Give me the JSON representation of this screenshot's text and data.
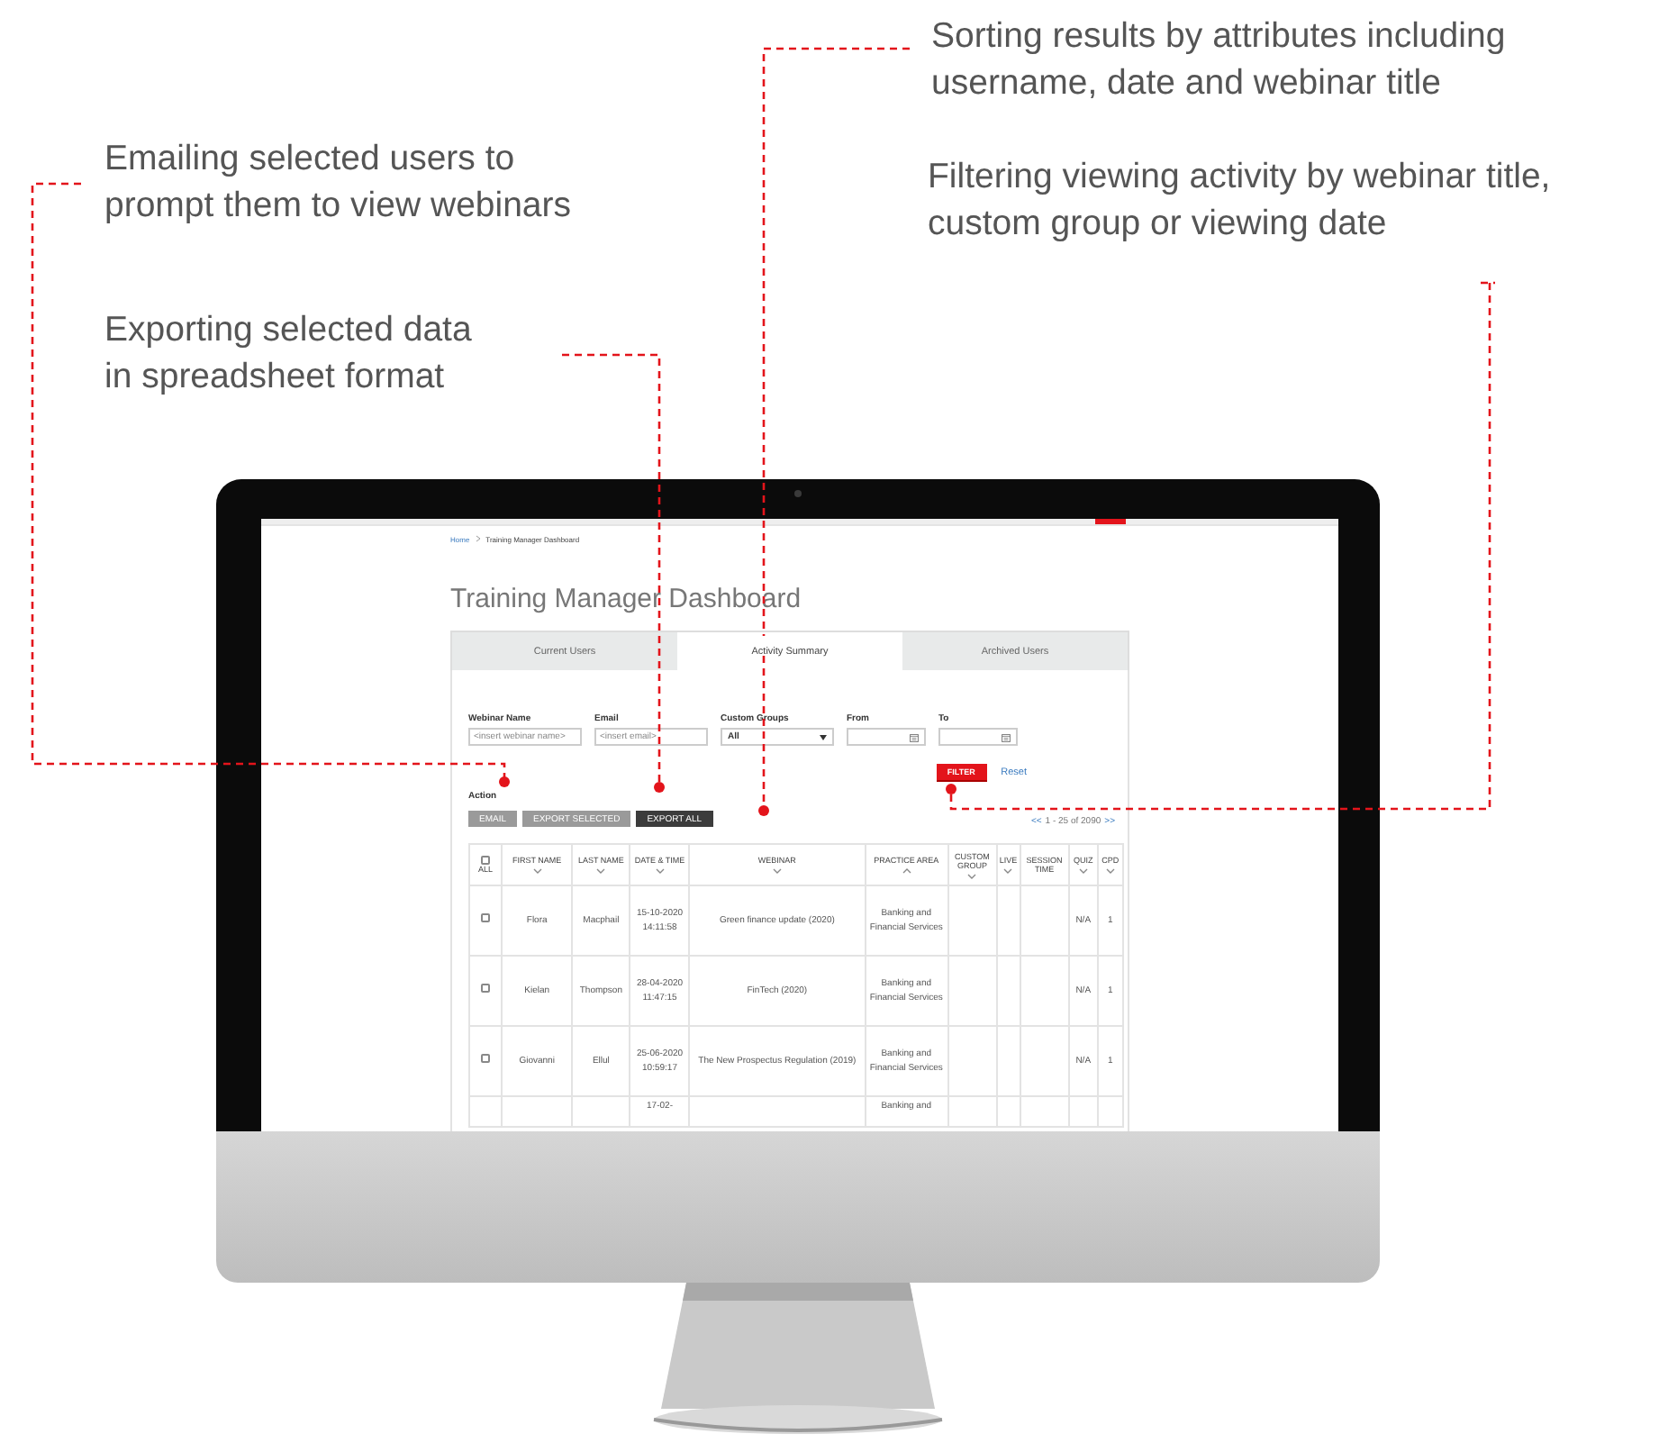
{
  "annotations": [
    {
      "lines": [
        "Sorting results by attributes including",
        "username, date and webinar title"
      ]
    },
    {
      "lines": [
        "Emailing selected users to",
        "prompt them to view webinars"
      ]
    },
    {
      "lines": [
        "Filtering viewing activity by webinar title,",
        "custom group or viewing date"
      ]
    },
    {
      "lines": [
        "Exporting selected data",
        "in spreadsheet format"
      ]
    }
  ],
  "app": {
    "breadcrumb": [
      "Home",
      "Training Manager Dashboard"
    ],
    "title": "Training Manager Dashboard",
    "tabs": [
      {
        "label": "Current Users",
        "selected": false
      },
      {
        "label": "Activity Summary",
        "selected": true
      },
      {
        "label": "Archived Users",
        "selected": false
      }
    ],
    "filters": [
      {
        "kind": "text",
        "label": "Webinar Name",
        "placeholder": "<insert webinar name>"
      },
      {
        "kind": "text",
        "label": "Email",
        "placeholder": "<insert email>"
      },
      {
        "kind": "select",
        "label": "Custom Groups",
        "value": "All"
      },
      {
        "kind": "date",
        "label": "From"
      },
      {
        "kind": "date",
        "label": "To"
      }
    ],
    "filter_button": "FILTER",
    "reset_link": "Reset",
    "action_label": "Action",
    "actions": [
      {
        "label": "EMAIL",
        "disabled": true
      },
      {
        "label": "EXPORT SELECTED",
        "disabled": true
      },
      {
        "label": "EXPORT ALL",
        "disabled": false
      }
    ],
    "pagination": {
      "prev": "<<",
      "range": "1 - 25 of 2090",
      "next": ">>"
    },
    "table": {
      "columns": [
        {
          "label": "ALL",
          "kind": "checkbox",
          "checked": false
        },
        {
          "label": "FIRST NAME",
          "sortable": true,
          "ascending": false
        },
        {
          "label": "LAST NAME",
          "sortable": true,
          "ascending": false
        },
        {
          "label": "DATE & TIME",
          "sortable": true,
          "ascending": false
        },
        {
          "label": "WEBINAR",
          "sortable": true,
          "ascending": false
        },
        {
          "label": "PRACTICE AREA",
          "sortable": true,
          "ascending": true
        },
        {
          "label": "CUSTOM GROUP",
          "sortable": true,
          "ascending": false
        },
        {
          "label": "LIVE",
          "sortable": true,
          "ascending": false
        },
        {
          "label": "SESSION TIME",
          "sortable": false
        },
        {
          "label": "QUIZ",
          "sortable": true,
          "ascending": false
        },
        {
          "label": "CPD",
          "sortable": true,
          "ascending": false
        }
      ],
      "rows": [
        {
          "checked": false,
          "first_name": "Flora",
          "last_name": "Macphail",
          "date_time": "15-10-2020 14:11:58",
          "webinar": "Green finance update (2020)",
          "practice_area": "Banking and Financial Services",
          "quiz": "N/A",
          "cpd": "1"
        },
        {
          "checked": false,
          "first_name": "Kielan",
          "last_name": "Thompson",
          "date_time": "28-04-2020 11:47:15",
          "webinar": "FinTech (2020)",
          "practice_area": "Banking and Financial Services",
          "quiz": "N/A",
          "cpd": "1"
        },
        {
          "checked": false,
          "first_name": "Giovanni",
          "last_name": "Ellul",
          "date_time": "25-06-2020 10:59:17",
          "webinar": "The New Prospectus Regulation (2019)",
          "practice_area": "Banking and Financial Services",
          "quiz": "N/A",
          "cpd": "1"
        },
        {
          "date_time": "17-02-",
          "practice_area": "Banking and"
        }
      ]
    }
  }
}
